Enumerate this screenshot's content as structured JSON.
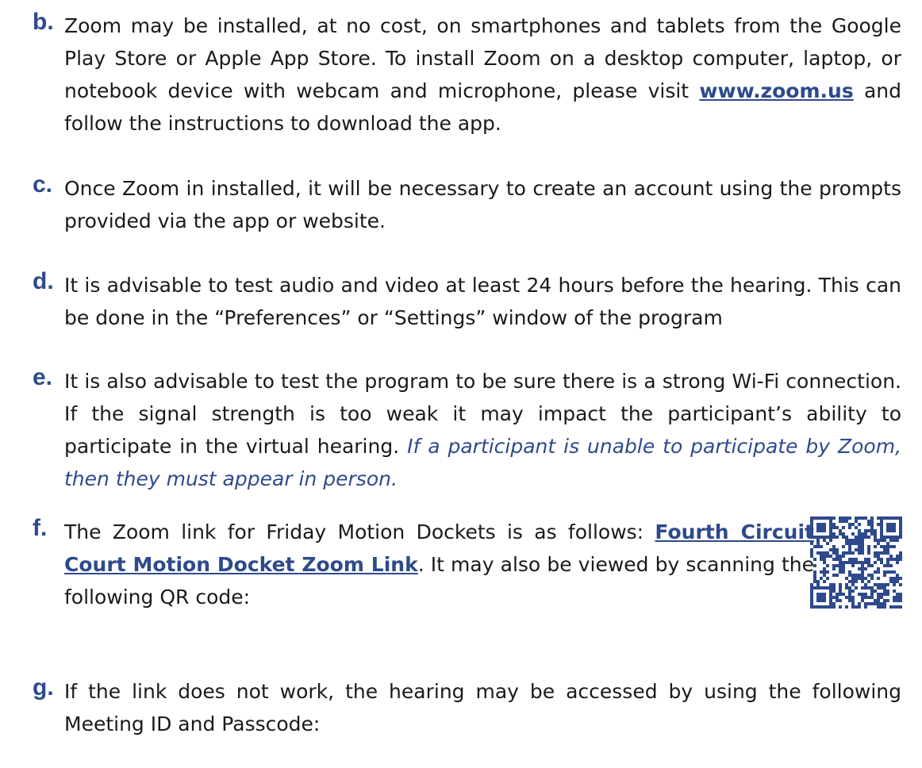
{
  "items": {
    "b": {
      "marker": "b.",
      "text1": "Zoom may be installed, at no cost, on smartphones and tablets from the Google Play Store or Apple App Store. To install Zoom on a desktop computer, laptop, or notebook device with webcam and microphone, please visit ",
      "link": "www.zoom.us",
      "text2": " and follow the instructions to download the app."
    },
    "c": {
      "marker": "c.",
      "text": "Once Zoom in installed, it will be necessary to create an account using the prompts provided via the app or website."
    },
    "d": {
      "marker": "d.",
      "text": "It is advisable to test audio and video at least 24 hours before the hearing. This can be done in the “Preferences” or “Settings” window of the program"
    },
    "e": {
      "marker": "e.",
      "text": "It is also advisable to test the program to be sure there is a strong Wi-Fi connection. If the signal strength is too weak it may impact the participant’s ability to participate in the virtual hearing. ",
      "note": "If a participant is unable to participate by Zoom, then they must appear in person."
    },
    "f": {
      "marker": "f.",
      "text1": "The Zoom link for Friday Motion Dockets is as follows: ",
      "link": "Fourth Circuit Court Motion Docket Zoom Link",
      "text2": ". It may also be viewed by scanning the following QR code:"
    },
    "g": {
      "marker": "g.",
      "text": "If the link does not work, the hearing may be accessed by using the following Meeting ID and Passcode:"
    }
  },
  "colors": {
    "accent": "#2e4a8c",
    "text": "#1a1a1a"
  },
  "icons": {
    "qr": "qr-code-icon"
  }
}
